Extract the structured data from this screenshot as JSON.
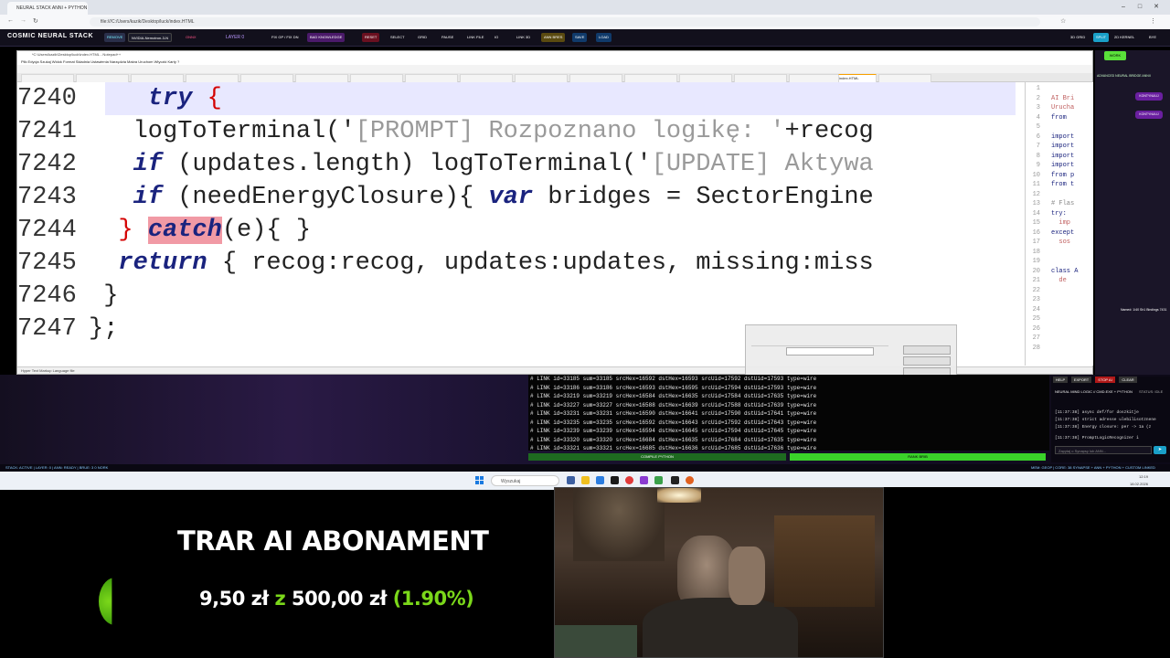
{
  "browser": {
    "tab_title": "NEURAL STACK ANNI + PYTHON P...",
    "url": "file:///C:/Users/kazik/Desktop/luck/index.HTML"
  },
  "toolbar": {
    "app_title": "COSMIC NEURAL STACK",
    "buttons": [
      "REMOVE",
      "NVIDIA-Nemotron-3-N",
      "ONNX",
      "LAYER 0",
      "FIX GP / FIX DN",
      "BAD KNOWLEDGE",
      "RESET",
      "SELECT",
      "GRID",
      "PAUSE",
      "LINK FILE",
      "IO",
      "LINK 3D",
      "ANN BRES",
      "SAVE",
      "LOAD",
      "3D GRID",
      "SPLIT",
      "2D KERNEL",
      "BYE"
    ]
  },
  "notepad": {
    "title": "*C:\\Users\\kazik\\Desktop\\luck\\index.HTML - Notepad++",
    "menu": "Plik  Edycja  Szukaj  Widok  Format  Składnia  Ustawienia  Narzędzia  Makra  Uruchom  Wtyczki  Karty  ?",
    "active_tab": "index.HTML",
    "status": "Hyper Text Markup Language file",
    "code": [
      {
        "num": "7240",
        "indent": "  ",
        "kw1": "try",
        "rest": " {",
        "brace": "{"
      },
      {
        "num": "7241",
        "text": "   logToTerminal('",
        "str": "[PROMPT] Rozpoznano logikę: '",
        "tail": "+recog"
      },
      {
        "num": "7242",
        "kw1": "if",
        "text": " (updates.length) logToTerminal('",
        "str": "[UPDATE] Aktywa"
      },
      {
        "num": "7243",
        "kw1": "if",
        "text": " (needEnergyClosure){ ",
        "kw2": "var",
        "tail": " bridges = SectorEngine"
      },
      {
        "num": "7244",
        "kw1": "catch",
        "text": "(e){ }"
      },
      {
        "num": "7245",
        "kw1": "return",
        "text": " { recog:recog, updates:updates, missing:miss"
      },
      {
        "num": "7246",
        "text": "}"
      },
      {
        "num": "7247",
        "text": "};"
      }
    ],
    "right_lines": [
      {
        "n": "1",
        "t": ""
      },
      {
        "n": "2",
        "t": "AI Bri"
      },
      {
        "n": "3",
        "t": "Urucha"
      },
      {
        "n": "4",
        "t": "from"
      },
      {
        "n": "5",
        "t": ""
      },
      {
        "n": "6",
        "t": "import"
      },
      {
        "n": "7",
        "t": "import"
      },
      {
        "n": "8",
        "t": "import"
      },
      {
        "n": "9",
        "t": "import"
      },
      {
        "n": "10",
        "t": "from p"
      },
      {
        "n": "11",
        "t": "from t"
      },
      {
        "n": "12",
        "t": ""
      },
      {
        "n": "13",
        "t": "# Flas"
      },
      {
        "n": "14",
        "t": "try:"
      },
      {
        "n": "15",
        "t": "  imp"
      },
      {
        "n": "16",
        "t": "except"
      },
      {
        "n": "17",
        "t": "  sos"
      },
      {
        "n": "18",
        "t": ""
      },
      {
        "n": "19",
        "t": ""
      },
      {
        "n": "20",
        "t": "class A"
      },
      {
        "n": "21",
        "t": "  de"
      },
      {
        "n": "22",
        "t": ""
      },
      {
        "n": "23",
        "t": ""
      },
      {
        "n": "24",
        "t": ""
      },
      {
        "n": "25",
        "t": ""
      },
      {
        "n": "26",
        "t": ""
      },
      {
        "n": "27",
        "t": ""
      },
      {
        "n": "28",
        "t": ""
      }
    ]
  },
  "right_panel": {
    "work_button": "WORK",
    "header": "ADVANCED NEURAL BRIDGE ANNII",
    "buttons": [
      "KONTYNUUJ",
      "KONTYNUUJ"
    ],
    "node_info": "Named: 1/40  Sh1  Bindings 7431"
  },
  "console": {
    "lines": [
      "# LINK id=33185 sum=33185 srcHex=16592 dstHex=16593 srcUid=17592 dstUid=17593 type=wire",
      "# LINK id=33186 sum=33186 srcHex=16593 dstHex=16595 srcUid=17594 dstUid=17593 type=wire",
      "# LINK id=33219 sum=33219 srcHex=16584 dstHex=16635 srcUid=17584 dstUid=17635 type=wire",
      "# LINK id=33227 sum=33227 srcHex=16588 dstHex=16639 srcUid=17588 dstUid=17639 type=wire",
      "# LINK id=33231 sum=33231 srcHex=16590 dstHex=16641 srcUid=17590 dstUid=17641 type=wire",
      "# LINK id=33235 sum=33235 srcHex=16592 dstHex=16643 srcUid=17592 dstUid=17643 type=wire",
      "# LINK id=33239 sum=33239 srcHex=16594 dstHex=16645 srcUid=17594 dstUid=17645 type=wire",
      "# LINK id=33320 sum=33320 srcHex=16684 dstHex=16635 srcUid=17684 dstUid=17635 type=wire",
      "# LINK id=33321 sum=33321 srcHex=16685 dstHex=16636 srcUid=17685 dstUid=17636 type=wire"
    ],
    "compile_label": "COMPILE PYTHON",
    "run_label": "RANK BRIB"
  },
  "neural_panel": {
    "buttons": [
      "HELP",
      "EXPORT",
      "STOP AI",
      "CLEAR"
    ],
    "title": "NEURAL MIND LOGIC // CMD.EXE + PYTHON",
    "status": "STATUS: IDLE",
    "log": [
      "[11:37:38] async def/for doszkitje",
      "[11:37:38] strict adresse ulebilisotznene",
      "[11:37:38] Energy closure: per -> 1a (z",
      "[11:37:38] PromptLogicRecognizer i"
    ],
    "input_placeholder": "Zapytaj o Synapsy lub ANN..."
  },
  "status_bar": {
    "left": "STACK: ACTIVE | LAYER: 0 | ANN: READY | BRUE: 3 0 NORK",
    "right": "MEM: GEOP | CORE: 38 SYNAPSE + ANN + PYTHON + CUSTOM LINKED"
  },
  "taskbar": {
    "search_placeholder": "Wyszukaj",
    "time": "12:19",
    "date": "18.02.2026"
  },
  "overlay": {
    "title": "TRAR AI ABONAMENT",
    "amount_current": "9,50 zł",
    "amount_connector": "z",
    "amount_target": "500,00 zł",
    "percent": "(1.90%)",
    "progress_fraction": 0.019,
    "accent": "#7bd81a"
  }
}
